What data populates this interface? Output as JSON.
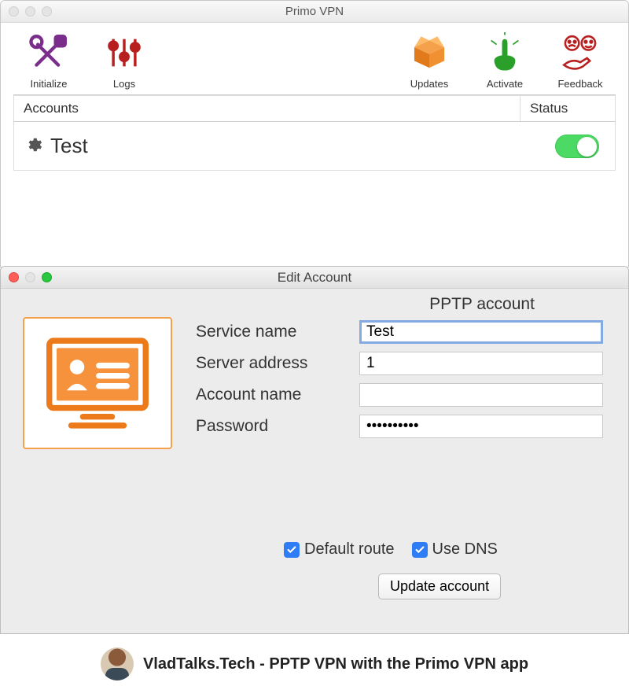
{
  "mainWindow": {
    "title": "Primo VPN",
    "toolbar": {
      "initialize": "Initialize",
      "logs": "Logs",
      "updates": "Updates",
      "activate": "Activate",
      "feedback": "Feedback"
    },
    "listHeader": {
      "accounts": "Accounts",
      "status": "Status"
    },
    "account": {
      "name": "Test",
      "on": true
    }
  },
  "editWindow": {
    "title": "Edit Account",
    "groupTitle": "PPTP account",
    "labels": {
      "service": "Service name",
      "server": "Server address",
      "account": "Account name",
      "password": "Password"
    },
    "values": {
      "service": "Test",
      "server": "1",
      "account": "",
      "password": "••••••••••"
    },
    "checks": {
      "defaultRoute": "Default route",
      "useDNS": "Use DNS"
    },
    "updateBtn": "Update account"
  },
  "caption": "VladTalks.Tech - PPTP VPN with the Primo VPN app"
}
